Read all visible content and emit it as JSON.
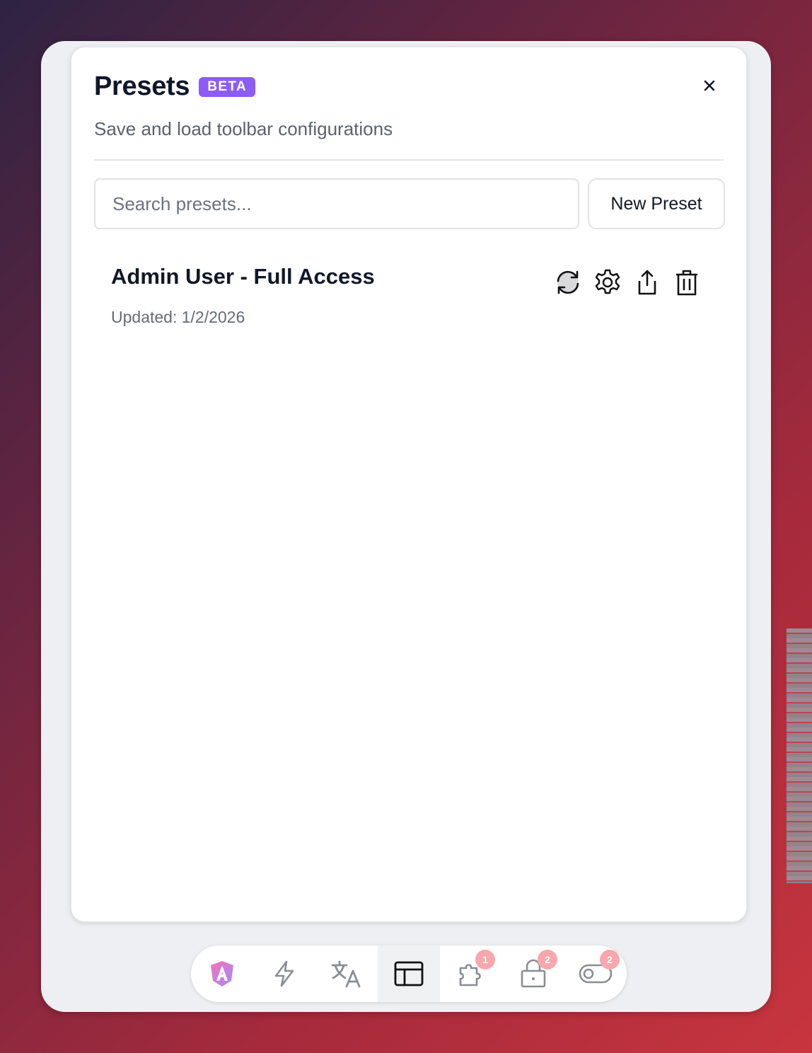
{
  "dialog": {
    "title": "Presets",
    "badge": "BETA",
    "subtitle": "Save and load toolbar configurations"
  },
  "search": {
    "value": "",
    "placeholder": "Search presets..."
  },
  "new_preset_label": "New Preset",
  "presets": [
    {
      "name": "Admin User - Full Access",
      "updated": "Updated: 1/2/2026",
      "actions": [
        "refresh-icon",
        "gear-icon",
        "share-icon",
        "trash-icon"
      ]
    }
  ],
  "dock": {
    "items": [
      {
        "icon": "angular-logo-icon",
        "badge": ""
      },
      {
        "icon": "lightning-icon",
        "badge": ""
      },
      {
        "icon": "translate-icon",
        "badge": ""
      },
      {
        "icon": "layout-icon",
        "badge": "",
        "active": true
      },
      {
        "icon": "puzzle-icon",
        "badge": "1"
      },
      {
        "icon": "lock-icon",
        "badge": "2"
      },
      {
        "icon": "toggle-icon",
        "badge": "2"
      }
    ]
  },
  "colors": {
    "accent": "#8b5cf6",
    "badge": "#f8a8ad",
    "text": "#0f172a",
    "muted": "#5b6170"
  }
}
